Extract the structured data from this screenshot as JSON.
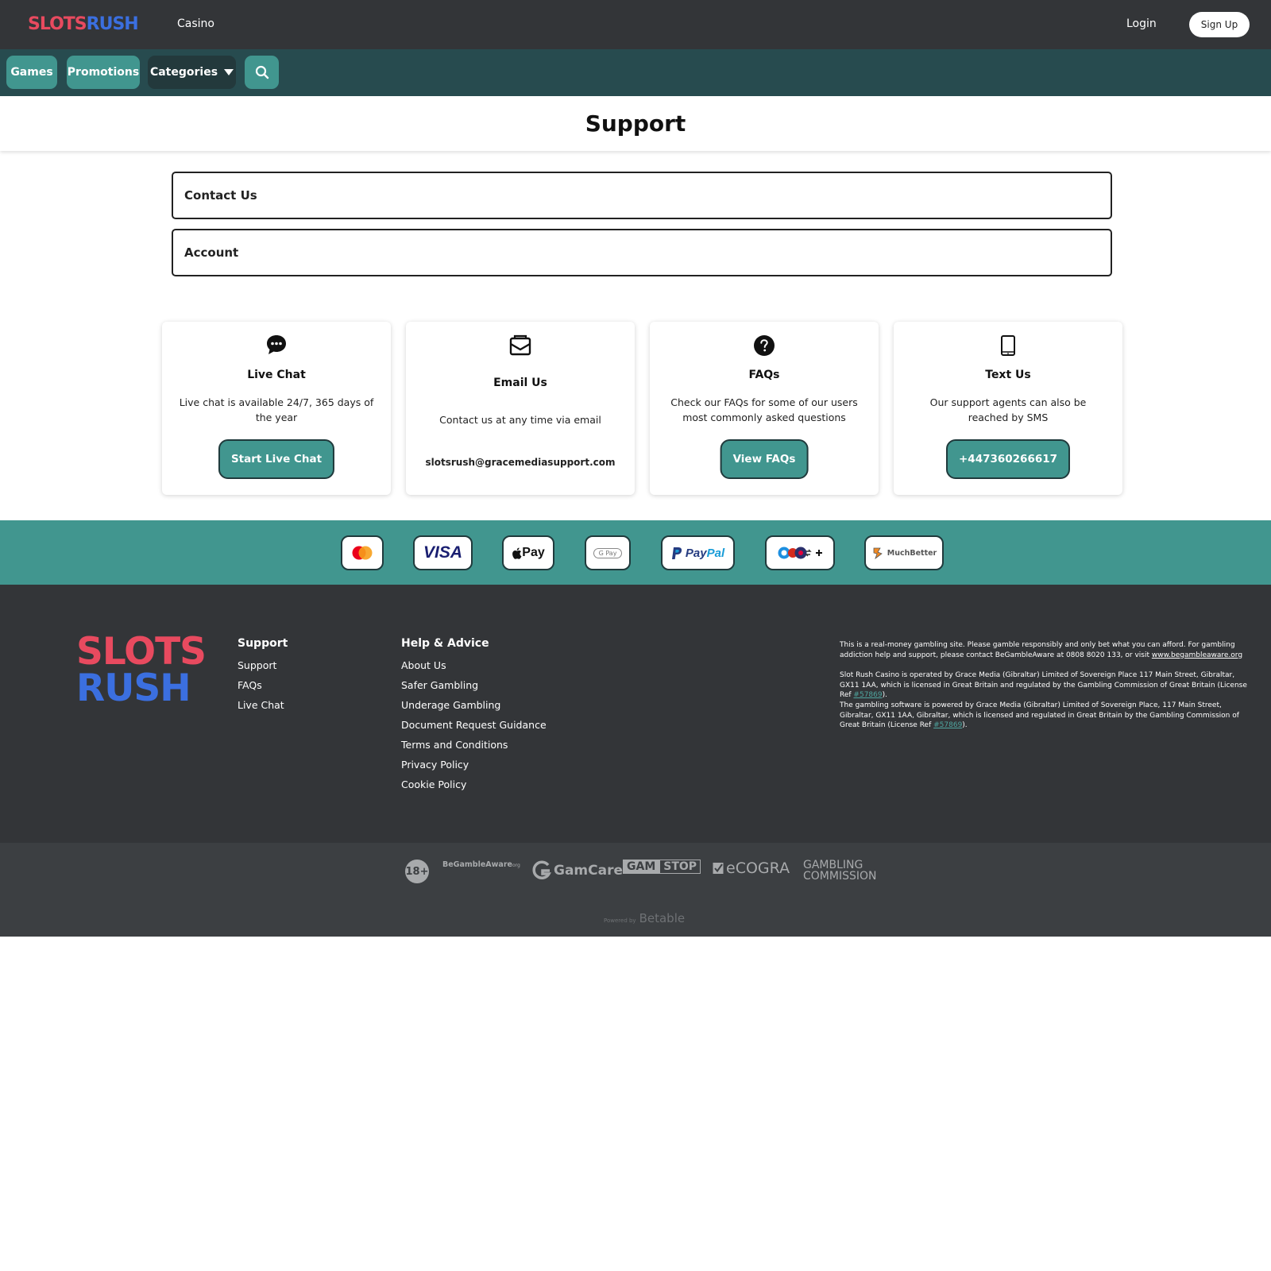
{
  "header": {
    "logo_part1": "SLOTS",
    "logo_part2": "RUSH",
    "casino_link": "Casino",
    "login_link": "Login",
    "signup_button": "Sign Up"
  },
  "nav": {
    "games": "Games",
    "promotions": "Promotions",
    "categories": "Categories"
  },
  "page": {
    "title": "Support"
  },
  "accordions": [
    {
      "label": "Contact Us"
    },
    {
      "label": "Account"
    }
  ],
  "cards": {
    "live_chat": {
      "title": "Live Chat",
      "description": "Live chat is available 24/7, 365 days of the year",
      "button": "Start Live Chat",
      "icon": "chat-bubble-icon"
    },
    "email": {
      "title": "Email Us",
      "description": "Contact us at any time via email",
      "address": "slotsrush@gracemediasupport.com",
      "icon": "envelope-icon"
    },
    "faqs": {
      "title": "FAQs",
      "description": "Check our FAQs for some of our users most commonly asked questions",
      "button": "View FAQs",
      "icon": "question-circle-icon"
    },
    "text": {
      "title": "Text Us",
      "description": "Our support agents can also be reached by SMS",
      "button": "+447360266617",
      "icon": "mobile-phone-icon"
    }
  },
  "payments": {
    "visa": "VISA",
    "apple_pay": "Pay",
    "google_pay": "G Pay",
    "paypal_p1": "Pay",
    "paypal_p2": "Pal",
    "muchbetter": "MuchBetter"
  },
  "footer": {
    "logo_part1": "SLOTS",
    "logo_part2": "RUSH",
    "support": {
      "title": "Support",
      "links": [
        "Support",
        "FAQs",
        "Live Chat"
      ]
    },
    "help": {
      "title": "Help & Advice",
      "links": [
        "About Us",
        "Safer Gambling",
        "Underage Gambling",
        "Document Request Guidance",
        "Terms and Conditions",
        "Privacy Policy",
        "Cookie Policy"
      ]
    },
    "legal": {
      "p1_a": "This is a real-money gambling site. Please gamble responsibly and only bet what you can afford. For gambling addiction help and support, please contact BeGambleAware at 0808 8020 133, or visit ",
      "p1_link": "www.begambleaware.org",
      "p2_a": "Slot Rush Casino is operated by Grace Media (Gibraltar) Limited of Sovereign Place 117 Main Street, Gibraltar, GX11 1AA, which is licensed in Great Britain and regulated by the Gambling Commission of Great Britain (License Ref ",
      "p2_ref": "#57869",
      "p2_b": ").",
      "p3_a": "The gambling software is powered by Grace Media (Gibraltar) Limited of Sovereign Place, 117 Main Street, Gibraltar, GX11 1AA, Gibraltar, which is licensed and regulated in Great Britain by the Gambling Commission of Great Britain (License Ref ",
      "p3_ref": "#57869",
      "p3_b": ")."
    }
  },
  "regulators": {
    "age": "18+",
    "begambleaware": "BeGambleAware",
    "begambleaware_suffix": "org",
    "gamcare": "GamCare",
    "gamstop_a": "GAM",
    "gamstop_b": "STOP",
    "ecogra": "eCOGRA",
    "gambling_commission_1": "GAMBLING",
    "gambling_commission_2": "COMMISSION",
    "powered_by": "Powered by",
    "betable": "Betable"
  },
  "colors": {
    "topbar": "#333538",
    "navbar": "#274b4f",
    "teal": "#41968f",
    "footer": "#333538",
    "logo_red": "#e84a5f",
    "logo_blue": "#3b6fe0"
  }
}
